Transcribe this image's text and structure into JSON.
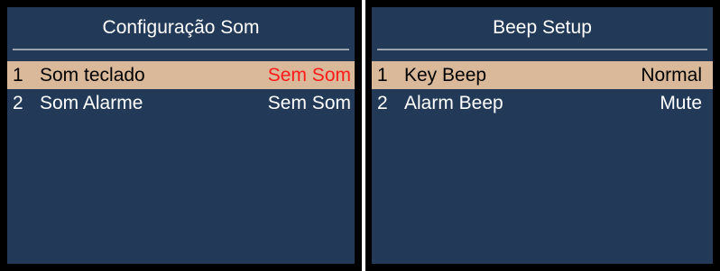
{
  "left_panel": {
    "title": "Configuração Som",
    "items": [
      {
        "number": "1",
        "label": "Som teclado",
        "value": "Sem Som",
        "selected": true,
        "value_color": "#ff1a1a"
      },
      {
        "number": "2",
        "label": "Som Alarme",
        "value": "Sem Som",
        "selected": false
      }
    ]
  },
  "right_panel": {
    "title": "Beep Setup",
    "items": [
      {
        "number": "1",
        "label": "Key Beep",
        "value": "Normal",
        "selected": true
      },
      {
        "number": "2",
        "label": "Alarm Beep",
        "value": "Mute",
        "selected": false
      }
    ]
  },
  "colors": {
    "screen_background": "#223a57",
    "selection_highlight": "#d9b99a",
    "bezel": "#000000",
    "title_rule": "#9aa3ad"
  }
}
